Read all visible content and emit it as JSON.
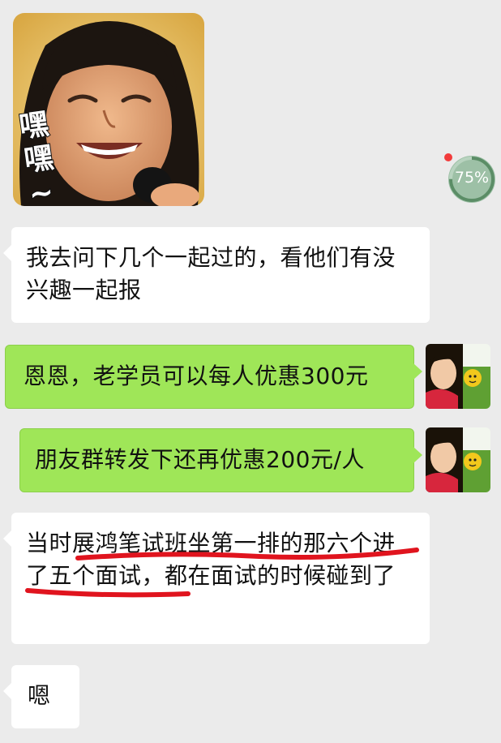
{
  "sticker": {
    "caption": "嘿嘿~"
  },
  "status": {
    "progress_text": "75%",
    "progress_value": 0.75
  },
  "messages": [
    {
      "side": "left",
      "text": "我去问下几个一起过的，看他们有没兴趣一起报"
    },
    {
      "side": "right",
      "text": "恩恩，老学员可以每人优惠300元"
    },
    {
      "side": "right",
      "text": "朋友群转发下还再优惠200元/人"
    },
    {
      "side": "left",
      "text": "当时展鸿笔试班坐第一排的那六个进了五个面试，都在面试的时候碰到了"
    },
    {
      "side": "left",
      "text": "嗯"
    }
  ],
  "colors": {
    "background": "#ebebeb",
    "sent_bubble": "#9fe658",
    "received_bubble": "#ffffff",
    "annotation": "#e0141e"
  }
}
